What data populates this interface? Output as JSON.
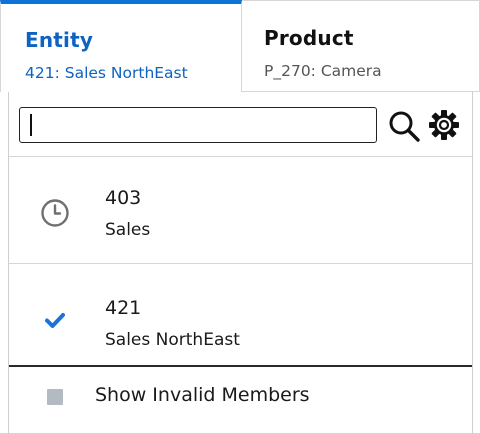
{
  "tabs": [
    {
      "title": "Entity",
      "subtitle": "421: Sales NorthEast",
      "active": true
    },
    {
      "title": "Product",
      "subtitle": "P_270: Camera",
      "active": false
    }
  ],
  "search": {
    "value": "",
    "placeholder": ""
  },
  "icons": {
    "search": "search-icon",
    "settings": "gear-icon"
  },
  "items": [
    {
      "code": "403",
      "name": "Sales",
      "icon": "clock-icon"
    },
    {
      "code": "421",
      "name": "Sales NorthEast",
      "icon": "checkmark-icon",
      "selected": true
    }
  ],
  "footer": {
    "label": "Show Invalid Members",
    "checked": false
  },
  "colors": {
    "accent": "#0e72d6",
    "active_text": "#0e63c2",
    "checkmark": "#1a73d9",
    "checkbox": "#b3bac1"
  }
}
